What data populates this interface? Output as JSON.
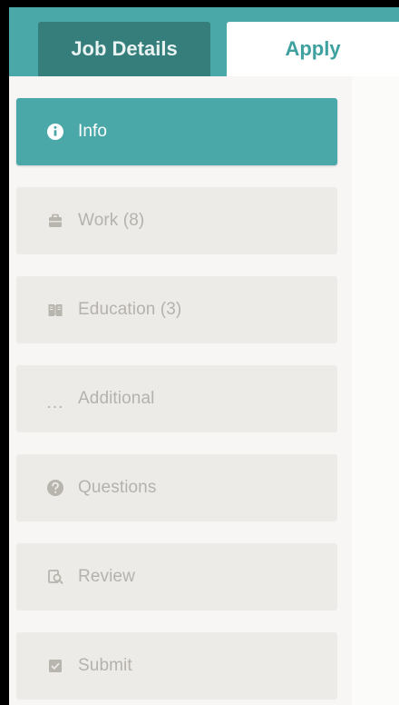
{
  "tabs": {
    "job_details": "Job Details",
    "apply": "Apply"
  },
  "steps": [
    {
      "label": "Info",
      "icon": "info-icon",
      "active": true
    },
    {
      "label": "Work (8)",
      "icon": "briefcase-icon",
      "active": false
    },
    {
      "label": "Education (3)",
      "icon": "book-icon",
      "active": false
    },
    {
      "label": "Additional",
      "icon": "ellipsis-icon",
      "active": false
    },
    {
      "label": "Questions",
      "icon": "question-icon",
      "active": false
    },
    {
      "label": "Review",
      "icon": "review-icon",
      "active": false
    },
    {
      "label": "Submit",
      "icon": "submit-icon",
      "active": false
    }
  ],
  "colors": {
    "teal": "#4aa8a8",
    "dark_teal": "#357e7c",
    "inactive_step": "#edebe8",
    "inactive_text": "#b5b2ad"
  }
}
